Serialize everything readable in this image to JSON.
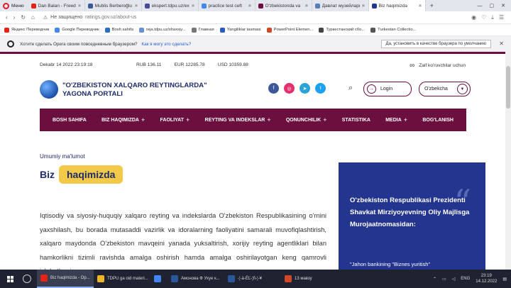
{
  "browser": {
    "menu_label": "Меню",
    "tabs": [
      {
        "label": "Dan Balan - Freed",
        "color": "#e62117",
        "active": false
      },
      {
        "label": "Mublis Berberoğlu",
        "color": "#3b5998",
        "active": false
      },
      {
        "label": "ekspert.tdpu.uz/ex",
        "color": "#4a4a9c",
        "active": false
      },
      {
        "label": "practice test ceft",
        "color": "#4285f4",
        "active": false
      },
      {
        "label": "O'zbekistonda va",
        "color": "#6a0f3e",
        "active": false
      },
      {
        "label": "Давлат музейлари",
        "color": "#5b7db8",
        "active": false
      },
      {
        "label": "Biz haqimizda",
        "color": "#24358f",
        "active": true
      }
    ],
    "new_tab": "+",
    "url_warning": "Не защищено",
    "url_host": "ratings.gov.uz/about-us",
    "bookmarks": [
      {
        "label": "Яндекс Переводчик",
        "color": "#e62117"
      },
      {
        "label": "Google Переводчик",
        "color": "#4285f4"
      },
      {
        "label": "Bosh sahifa",
        "color": "#2b6cc4"
      },
      {
        "label": "reja.tdpu.uz/shaxsiy...",
        "color": "#6c8ed6"
      },
      {
        "label": "Главная",
        "color": "#777"
      },
      {
        "label": "Yangiliklar tasmasi",
        "color": "#2b59c3"
      },
      {
        "label": "PowerPoint Elemen...",
        "color": "#d24726"
      },
      {
        "label": "Туркестанский сбо...",
        "color": "#444"
      },
      {
        "label": "Turkestan Collectio...",
        "color": "#555"
      }
    ],
    "notification": {
      "text": "Хотите сделать Opera своим повседневным браузером?",
      "link": "Как я могу это сделать?",
      "button": "Да, установить в качестве браузера по умолчанию"
    }
  },
  "site": {
    "date": "Dekabr 14 2022 23:19:18",
    "rates": [
      "RUB 136.11",
      "EUR 12285.78",
      "USD 10359.88"
    ],
    "vision_label": "Zaif ko'ruvchilar uchun",
    "logo_line1": "\"O'ZBEKISTON XALQARO REYTINGLARDA\"",
    "logo_line2": "YAGONA PORTALI",
    "social": [
      {
        "icon": "facebook-icon",
        "glyph": "f",
        "color": "#3b5998"
      },
      {
        "icon": "instagram-icon",
        "glyph": "◎",
        "color": "#e1306c"
      },
      {
        "icon": "telegram-icon",
        "glyph": "➤",
        "color": "#2aa3d8"
      },
      {
        "icon": "twitter-icon",
        "glyph": "t",
        "color": "#1da1f2"
      }
    ],
    "login_label": "Login",
    "lang_label": "O'zbekcha",
    "nav": [
      {
        "label": "BOSH SAHIFA",
        "plus": ""
      },
      {
        "label": "BIZ HAQIMIZDA",
        "plus": "+"
      },
      {
        "label": "FAOLIYAT",
        "plus": "+"
      },
      {
        "label": "REYTING VA INDEKSLAR",
        "plus": "+"
      },
      {
        "label": "QONUNCHILIK",
        "plus": "+"
      },
      {
        "label": "STATISTIKA",
        "plus": ""
      },
      {
        "label": "MEDIA",
        "plus": "+"
      },
      {
        "label": "BOG'LANISH",
        "plus": ""
      }
    ],
    "breadcrumb": "Umumiy ma'lumot",
    "title_a": "Biz",
    "title_b": "haqimizda",
    "body": "Iqtisodiy va siyosiy-huquqiy xalqaro reyting va indekslarda O'zbekiston Respublikasining o'rnini yaxshilash, bu borada mutasaddi vazirlik va idoralarning faoliyatini samarali muvofiqlashtirish, xalqaro maydonda O'zbekiston mavqeini yanada yuksaltirish, xorijiy reyting agentliklari bilan hamkorlikni tizimli ravishda amalga oshirish hamda amalga oshirilayotgan keng qamrovli islohotlarni",
    "quote_title": "O'zbekiston Respublikasi Prezidenti Shavkat Mirziyoyevning Oliy Majlisga Murojaatnomasidan:",
    "quote_text": "\"Jahon bankining \"Biznes yuritish\"",
    "quote_mark": "“"
  },
  "taskbar": {
    "apps": [
      {
        "label": "Biz haqimizda - Op...",
        "color": "#e62117",
        "active": true
      },
      {
        "label": "TDPU ga oid materi...",
        "color": "#f0b429",
        "active": false
      },
      {
        "label": "",
        "color": "#4285f4",
        "active": false
      },
      {
        "label": "Амонова Ф Ухуе к...",
        "color": "#2b579a",
        "active": false
      },
      {
        "label": "-¦-à-ÉĽ-¦ñ-¦-¥",
        "color": "#2b579a",
        "active": false
      },
      {
        "label": "13 мавзу",
        "color": "#d24726",
        "active": false
      }
    ],
    "lang": "ENG",
    "time": "23:19",
    "date": "14.12.2022"
  }
}
